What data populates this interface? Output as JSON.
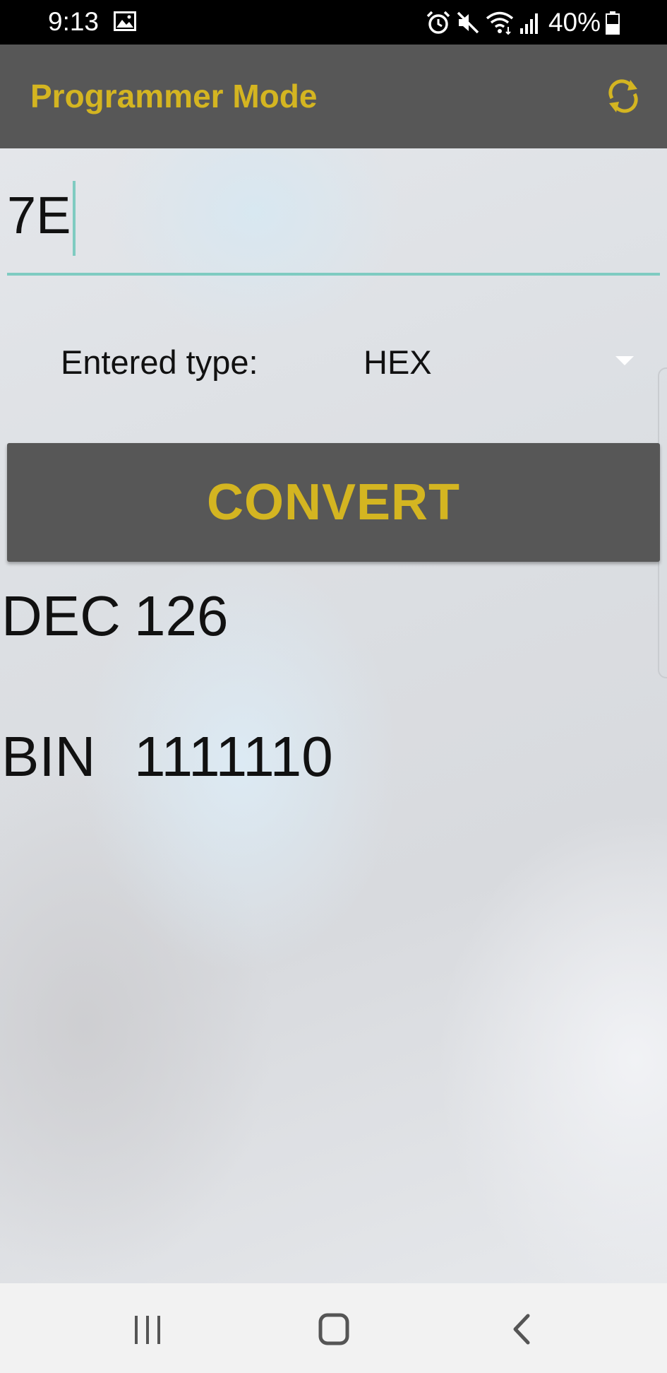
{
  "status_bar": {
    "time": "9:13",
    "battery": "40%",
    "icons": [
      "image-icon",
      "alarm-icon",
      "mute-icon",
      "wifi-icon",
      "signal-icon",
      "battery-icon"
    ]
  },
  "app_bar": {
    "title": "Programmer Mode",
    "refresh_icon": "refresh-icon"
  },
  "input": {
    "value": "7E"
  },
  "type_selector": {
    "label": "Entered type:",
    "selected": "HEX"
  },
  "convert": {
    "label": "CONVERT"
  },
  "results": [
    {
      "label": "DEC",
      "value": "126"
    },
    {
      "label": "BIN",
      "value": "1111110"
    }
  ],
  "nav_bar": {
    "icons": [
      "recents-icon",
      "home-icon",
      "back-icon"
    ]
  },
  "colors": {
    "accent": "#d4b521",
    "app_bar": "#575757",
    "underline": "#7fcbc1"
  }
}
